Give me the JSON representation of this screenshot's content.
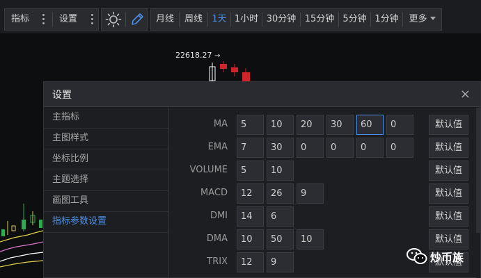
{
  "toolbar": {
    "indicator_label": "指标",
    "settings_label": "设置",
    "periods": [
      {
        "label": "月线",
        "active": false
      },
      {
        "label": "周线",
        "active": false
      },
      {
        "label": "1天",
        "active": true
      },
      {
        "label": "1小时",
        "active": false
      },
      {
        "label": "30分钟",
        "active": false
      },
      {
        "label": "15分钟",
        "active": false
      },
      {
        "label": "5分钟",
        "active": false
      },
      {
        "label": "1分钟",
        "active": false
      }
    ],
    "more_label": "更多"
  },
  "chart": {
    "price_label": "22618.27",
    "colors": {
      "up": "#ffffff",
      "down": "#d0242c",
      "green": "#2eaa55",
      "yellow": "#e0d04a",
      "pink": "#d872c8",
      "blue": "#4d8fe6"
    }
  },
  "dialog": {
    "title": "设置",
    "close": "×",
    "menu": [
      {
        "label": "主指标",
        "active": false
      },
      {
        "label": "主图样式",
        "active": false
      },
      {
        "label": "坐标比例",
        "active": false
      },
      {
        "label": "主题选择",
        "active": false
      },
      {
        "label": "画图工具",
        "active": false
      },
      {
        "label": "指标参数设置",
        "active": true
      }
    ],
    "default_label": "默认值",
    "params": [
      {
        "name": "MA",
        "values": [
          "5",
          "10",
          "20",
          "30",
          "60",
          "0"
        ],
        "focused_index": 4
      },
      {
        "name": "EMA",
        "values": [
          "7",
          "30",
          "0",
          "0",
          "0",
          "0"
        ],
        "focused_index": -1
      },
      {
        "name": "VOLUME",
        "values": [
          "5",
          "10"
        ],
        "focused_index": -1
      },
      {
        "name": "MACD",
        "values": [
          "12",
          "26",
          "9"
        ],
        "focused_index": -1
      },
      {
        "name": "DMI",
        "values": [
          "14",
          "6"
        ],
        "focused_index": -1
      },
      {
        "name": "DMA",
        "values": [
          "10",
          "50",
          "10"
        ],
        "focused_index": -1
      },
      {
        "name": "TRIX",
        "values": [
          "12",
          "9"
        ],
        "focused_index": -1
      }
    ],
    "accent_color": "#4d8fe6"
  },
  "watermark": {
    "text": "炒币族"
  }
}
